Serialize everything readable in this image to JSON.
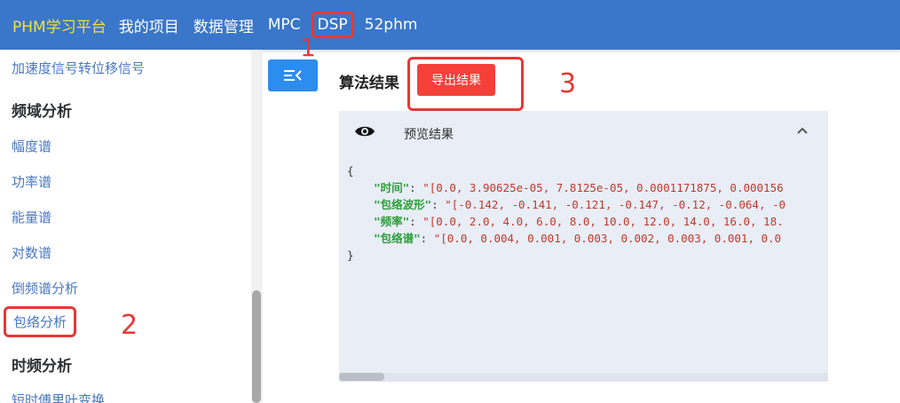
{
  "nav": {
    "brand": "PHM学习平台",
    "items": [
      "我的项目",
      "数据管理",
      "MPC",
      "DSP",
      "52phm"
    ]
  },
  "sidebar": {
    "top_item": "加速度信号转位移信号",
    "group_freq": "频域分析",
    "freq_items": [
      "幅度谱",
      "功率谱",
      "能量谱",
      "对数谱",
      "倒频谱分析",
      "包络分析"
    ],
    "group_timefreq": "时频分析",
    "bottom_item": "短时傅里叶变换"
  },
  "main": {
    "title": "算法结果",
    "export_label": "导出结果",
    "preview_label": "预览结果",
    "json_open": "{",
    "json_close": "}",
    "rows": [
      {
        "key": "\"时间\"",
        "value": "\"[0.0, 3.90625e-05, 7.8125e-05, 0.0001171875, 0.000156"
      },
      {
        "key": "\"包络波形\"",
        "value": "\"[-0.142, -0.141, -0.121, -0.147, -0.12, -0.064, -0"
      },
      {
        "key": "\"频率\"",
        "value": "\"[0.0, 2.0, 4.0, 6.0, 8.0, 10.0, 12.0, 14.0, 16.0, 18."
      },
      {
        "key": "\"包络谱\"",
        "value": "\"[0.0, 0.004, 0.001, 0.003, 0.002, 0.003, 0.001, 0.0"
      }
    ]
  },
  "annotations": [
    "1",
    "2",
    "3"
  ],
  "colors": {
    "topbar": "#3a76c9",
    "brand": "#f3e03a",
    "highlight": "#e53935",
    "primary": "#2d8cf0",
    "danger": "#f5403a"
  },
  "icons": [
    "collapse-menu-icon",
    "eye-icon",
    "chevron-up-icon"
  ]
}
